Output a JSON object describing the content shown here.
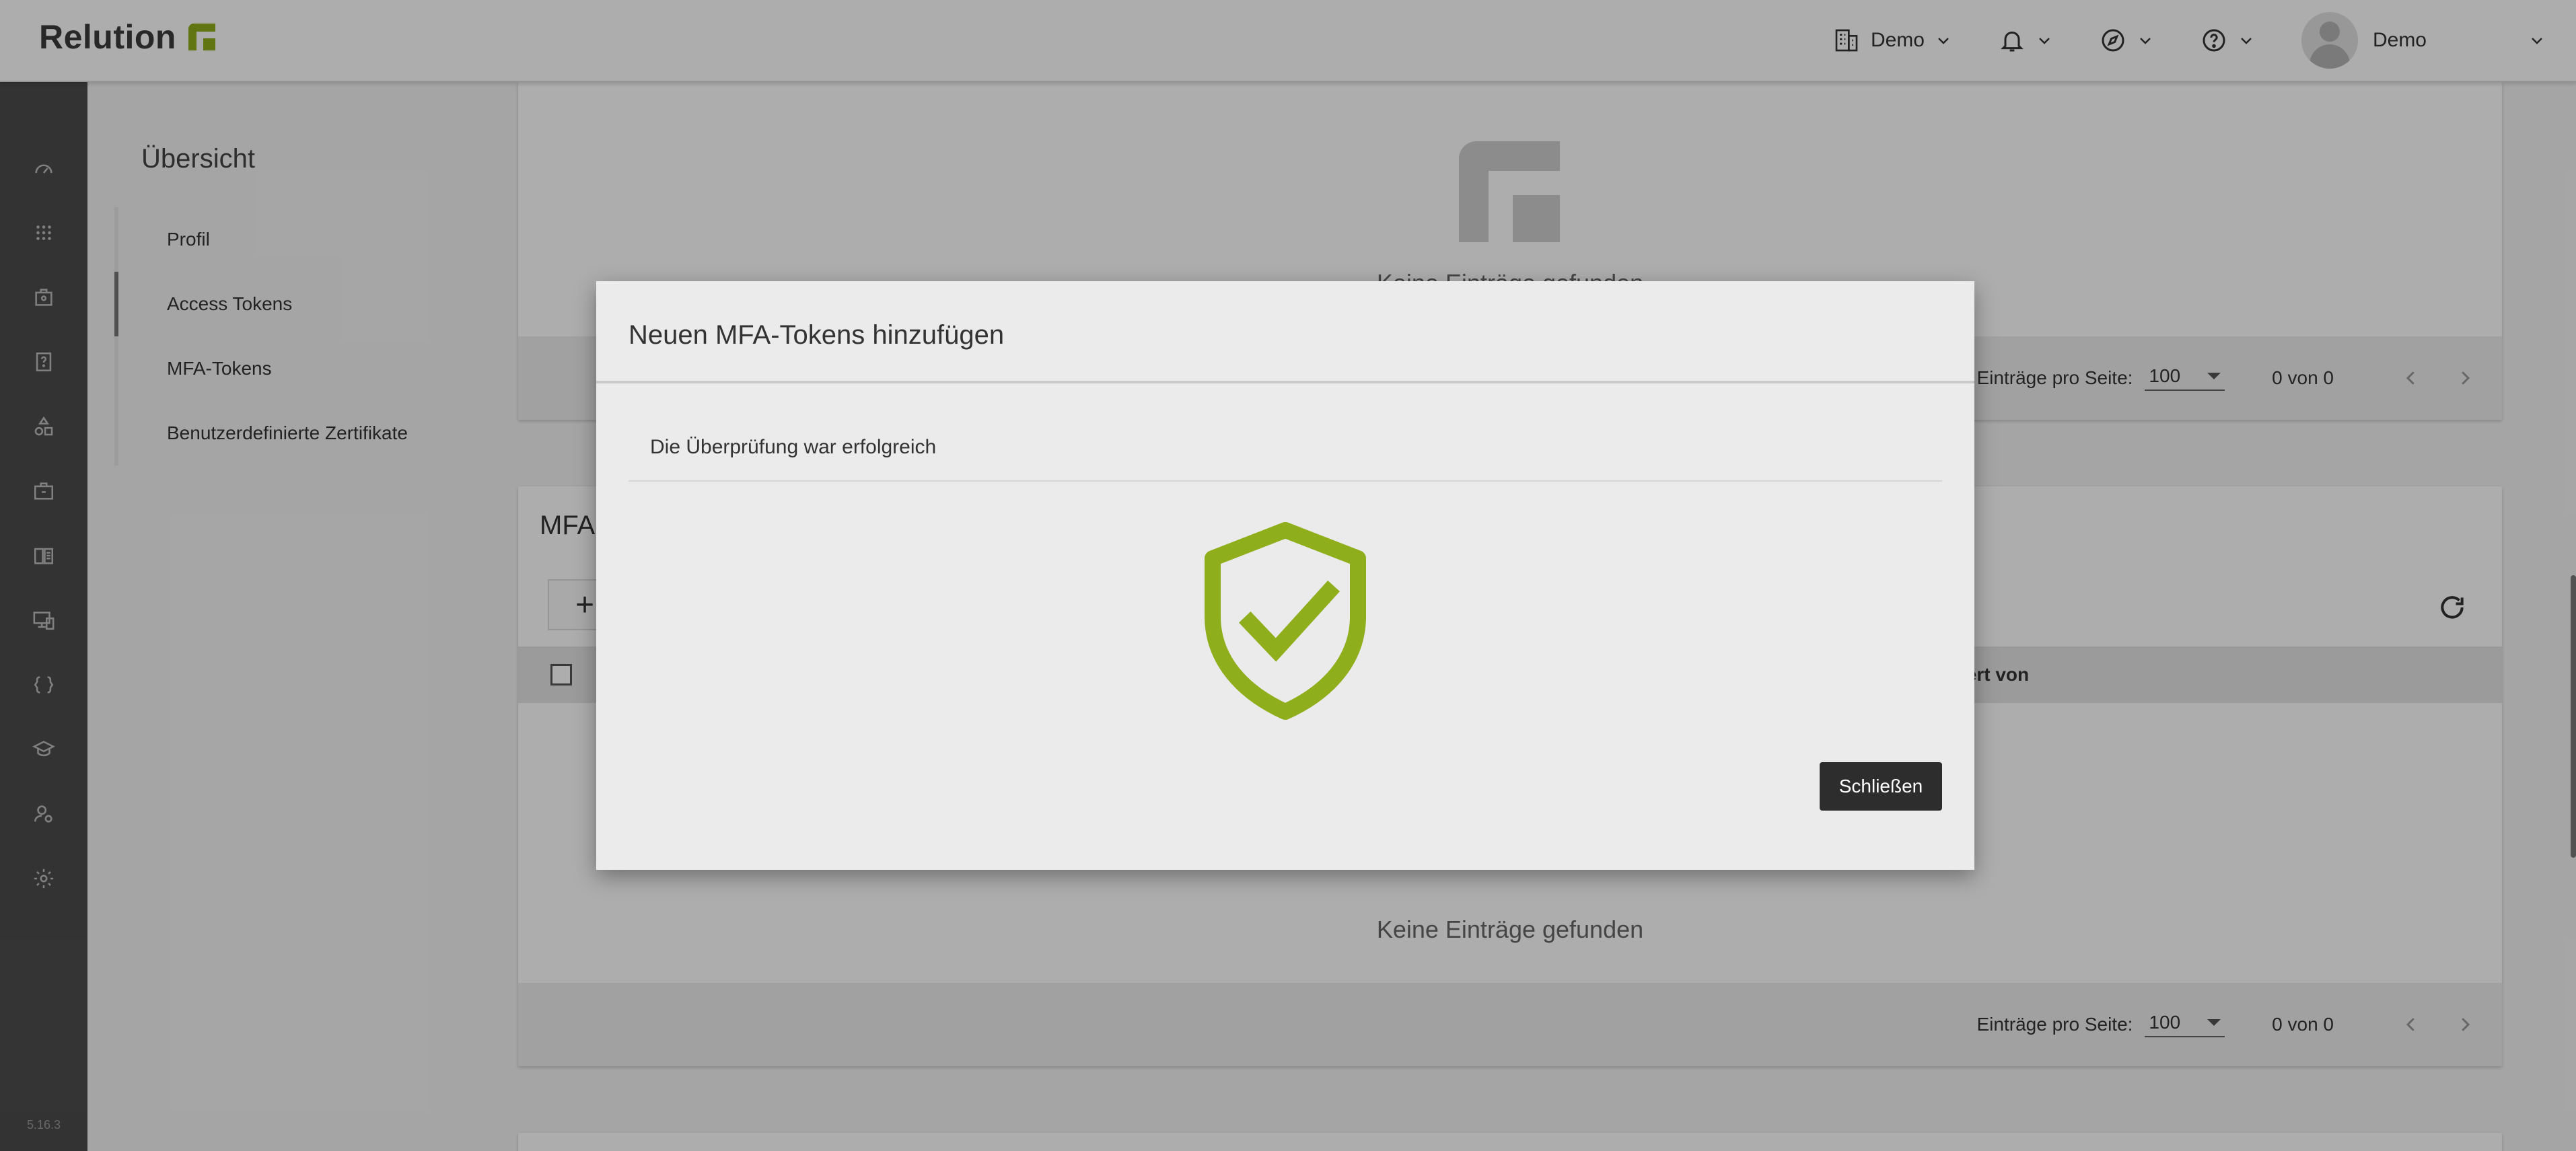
{
  "brand": {
    "name": "Relution",
    "color": "#8fae1b"
  },
  "header": {
    "organization": "Demo",
    "user": "Demo",
    "icons": [
      "building-icon",
      "bell-icon",
      "compass-icon",
      "help-icon"
    ]
  },
  "rail": {
    "icons": [
      "dashboard-icon",
      "apps-icon",
      "store-icon",
      "requests-icon",
      "policies-icon",
      "briefcase-icon",
      "book-icon",
      "devices-icon",
      "braces-icon",
      "education-icon",
      "users-icon",
      "settings-icon"
    ],
    "version": "5.16.3"
  },
  "subnav": {
    "title": "Übersicht",
    "items": [
      {
        "label": "Profil",
        "active": false
      },
      {
        "label": "Access Tokens",
        "active": true
      },
      {
        "label": "MFA-Tokens",
        "active": false
      },
      {
        "label": "Benutzerdefinierte Zertifikate",
        "active": false
      }
    ]
  },
  "panel_top": {
    "empty_text": "Keine Einträge gefunden",
    "per_page_label": "Einträge pro Seite:",
    "per_page_value": "100",
    "count": "0 von 0"
  },
  "panel_mfa": {
    "title_fragment": "MFA",
    "add_label": "+",
    "column_fragment": "ziert von",
    "empty_text": "Keine Einträge gefunden",
    "per_page_label": "Einträge pro Seite:",
    "per_page_value": "100",
    "count": "0 von 0"
  },
  "modal": {
    "title": "Neuen MFA-Tokens hinzufügen",
    "message": "Die Überprüfung war erfolgreich",
    "icon": "shield-check-icon",
    "icon_color": "#8fae1b",
    "close_label": "Schließen"
  }
}
